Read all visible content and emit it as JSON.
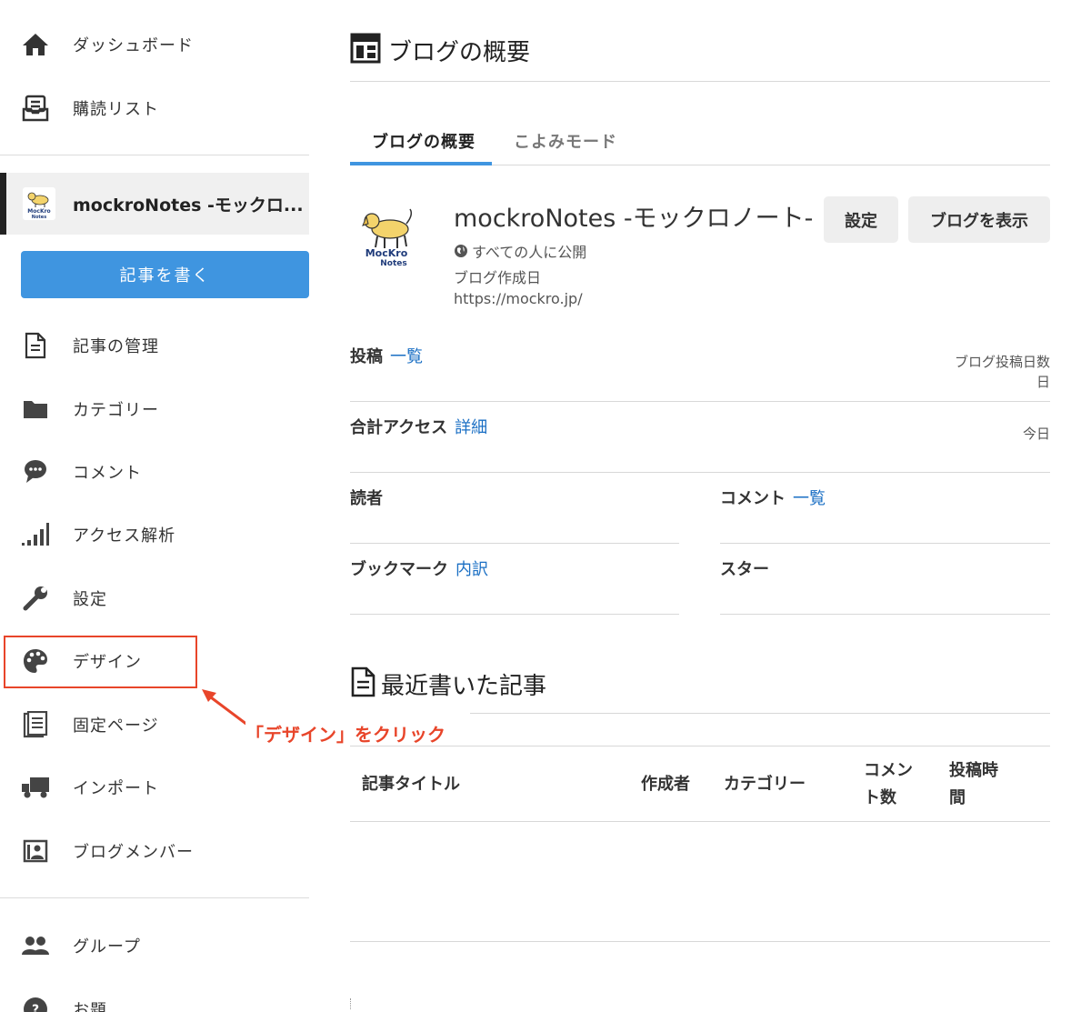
{
  "sidebar": {
    "top_items": [
      {
        "label": "ダッシュボード",
        "icon": "home-icon"
      },
      {
        "label": "購読リスト",
        "icon": "inbox-icon"
      }
    ],
    "blog_name": "mockroNotes -モックロ...",
    "write_button": "記事を書く",
    "items": [
      {
        "label": "記事の管理",
        "icon": "document-icon"
      },
      {
        "label": "カテゴリー",
        "icon": "folder-icon"
      },
      {
        "label": "コメント",
        "icon": "comment-icon"
      },
      {
        "label": "アクセス解析",
        "icon": "signal-bars-icon"
      },
      {
        "label": "設定",
        "icon": "wrench-icon"
      },
      {
        "label": "デザイン",
        "icon": "palette-icon"
      },
      {
        "label": "固定ページ",
        "icon": "page-icon"
      },
      {
        "label": "インポート",
        "icon": "truck-icon"
      },
      {
        "label": "ブログメンバー",
        "icon": "member-icon"
      }
    ],
    "bottom_items": [
      {
        "label": "グループ",
        "icon": "group-icon"
      },
      {
        "label": "お題",
        "icon": "topic-icon"
      }
    ]
  },
  "annotation": {
    "callout": "「デザイン」をクリック",
    "color": "#e8452a"
  },
  "main": {
    "title": "ブログの概要",
    "tabs": [
      {
        "label": "ブログの概要",
        "active": true
      },
      {
        "label": "こよみモード",
        "active": false
      }
    ],
    "blog": {
      "title": "mockroNotes -モックロノート-",
      "visibility": "すべての人に公開",
      "created_label": "ブログ作成日",
      "url": "https://mockro.jp/",
      "logo_text_1": "MocKro",
      "logo_text_2": "Notes"
    },
    "buttons": {
      "settings": "設定",
      "view_blog": "ブログを表示"
    },
    "stats": {
      "posts_label": "投稿",
      "posts_link": "一覧",
      "posts_right_1": "ブログ投稿日数",
      "posts_right_2": "日",
      "access_label": "合計アクセス",
      "access_link": "詳細",
      "access_right": "今日",
      "readers_label": "読者",
      "comments_label": "コメント",
      "comments_link": "一覧",
      "bookmarks_label": "ブックマーク",
      "bookmarks_link": "内訳",
      "stars_label": "スター"
    },
    "recent": {
      "title": "最近書いた記事",
      "columns": {
        "title": "記事タイトル",
        "author": "作成者",
        "category": "カテゴリー",
        "comments_1": "コメン",
        "comments_2": "ト数",
        "posted_1": "投稿時",
        "posted_2": "間"
      }
    }
  },
  "colors": {
    "accent": "#3f95e0",
    "link": "#1a6fc4",
    "annotation": "#e8452a"
  }
}
